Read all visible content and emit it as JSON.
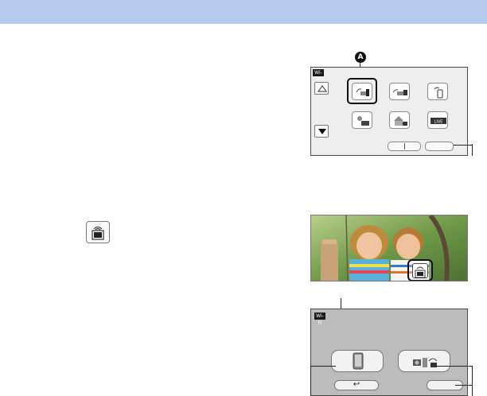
{
  "header": {
    "band_color": "#b7cbee"
  },
  "menu_screen": {
    "wifi_badge": "Wi-Fi",
    "scroll_up_icon": "triangle-up-icon",
    "scroll_down_icon": "triangle-down-icon",
    "functions": [
      {
        "icon": "remote-view-icon",
        "selected": true
      },
      {
        "icon": "baby-monitor-icon"
      },
      {
        "icon": "smartphone-connect-icon"
      },
      {
        "icon": "tv-playback-icon"
      },
      {
        "icon": "home-monitor-icon"
      },
      {
        "icon": "live-cast-icon",
        "label": "LIVE"
      }
    ],
    "callout_label": "A"
  },
  "photo_screen": {
    "wifi_button_icon": "wifi-icon"
  },
  "body_icon": {
    "icon": "wifi-icon"
  },
  "connection_screen": {
    "wifi_badge": "Wi-Fi",
    "options": [
      {
        "icon": "smartphone-icon"
      },
      {
        "icon": "camera-network-icon"
      }
    ],
    "back_label": "↩"
  }
}
